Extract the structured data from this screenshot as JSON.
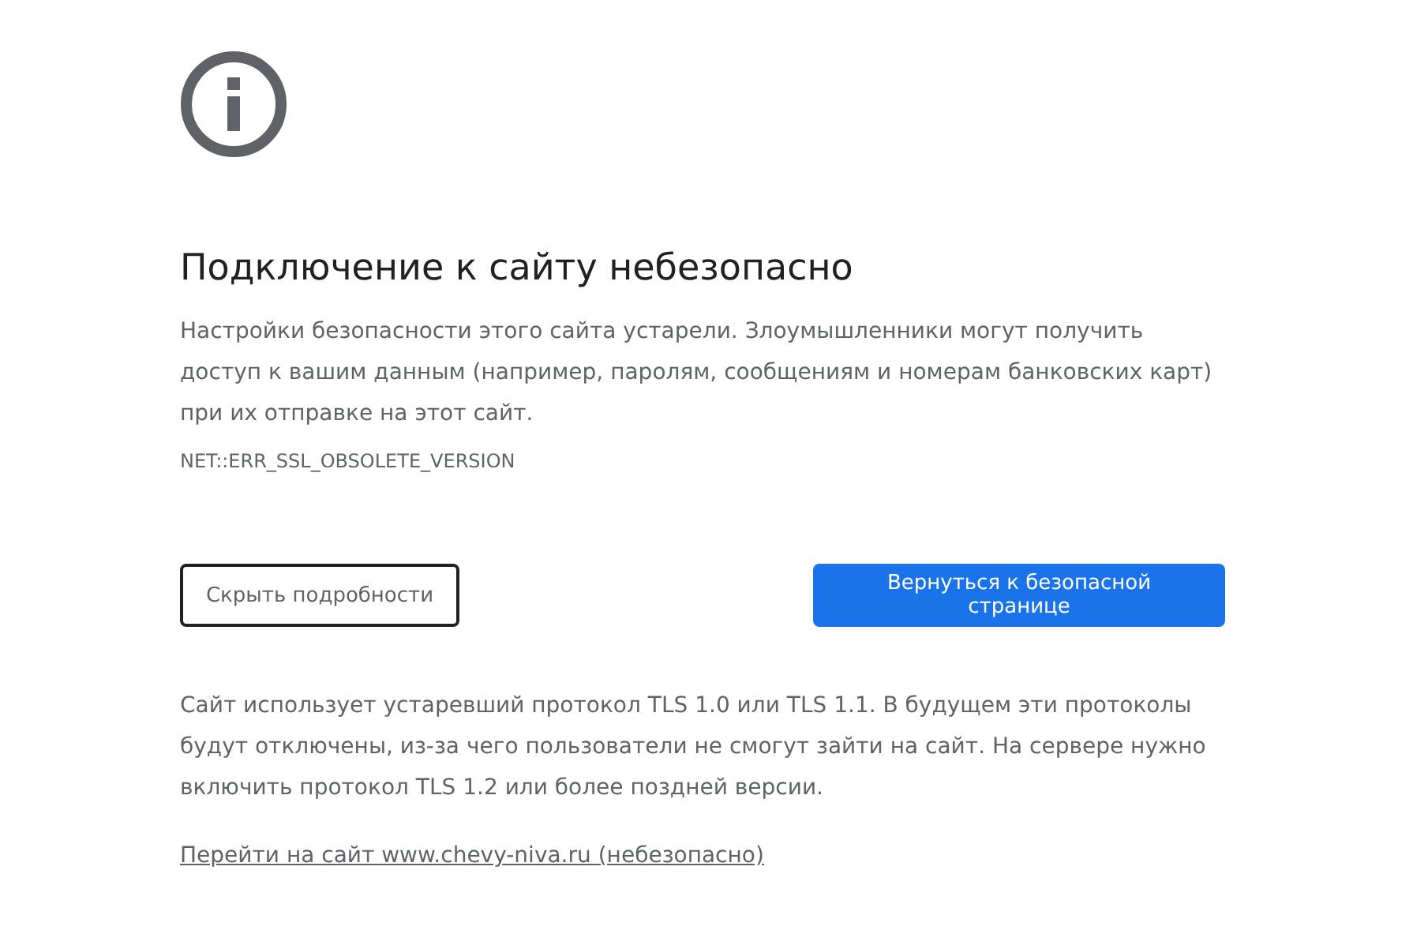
{
  "heading": "Подключение к сайту небезопасно",
  "message": "Настройки безопасности этого сайта устарели. Злоумышленники могут получить доступ к вашим данным (например, паролям, сообщениям и номерам банковских карт) при их отправке на этот сайт.",
  "error_code": "NET::ERR_SSL_OBSOLETE_VERSION",
  "buttons": [
    {
      "label": "Скрыть подробности",
      "kind": "secondary"
    },
    {
      "label": "Вернуться к безопасной странице",
      "kind": "primary"
    }
  ],
  "details": "Сайт использует устаревший протокол TLS 1.0 или TLS 1.1. В будущем эти протоколы будут отключены, из-за чего пользователи не смогут зайти на сайт. На сервере нужно включить протокол TLS 1.2 или более поздней версии.",
  "proceed_link": "Перейти на сайт www.chevy-niva.ru (небезопасно)"
}
